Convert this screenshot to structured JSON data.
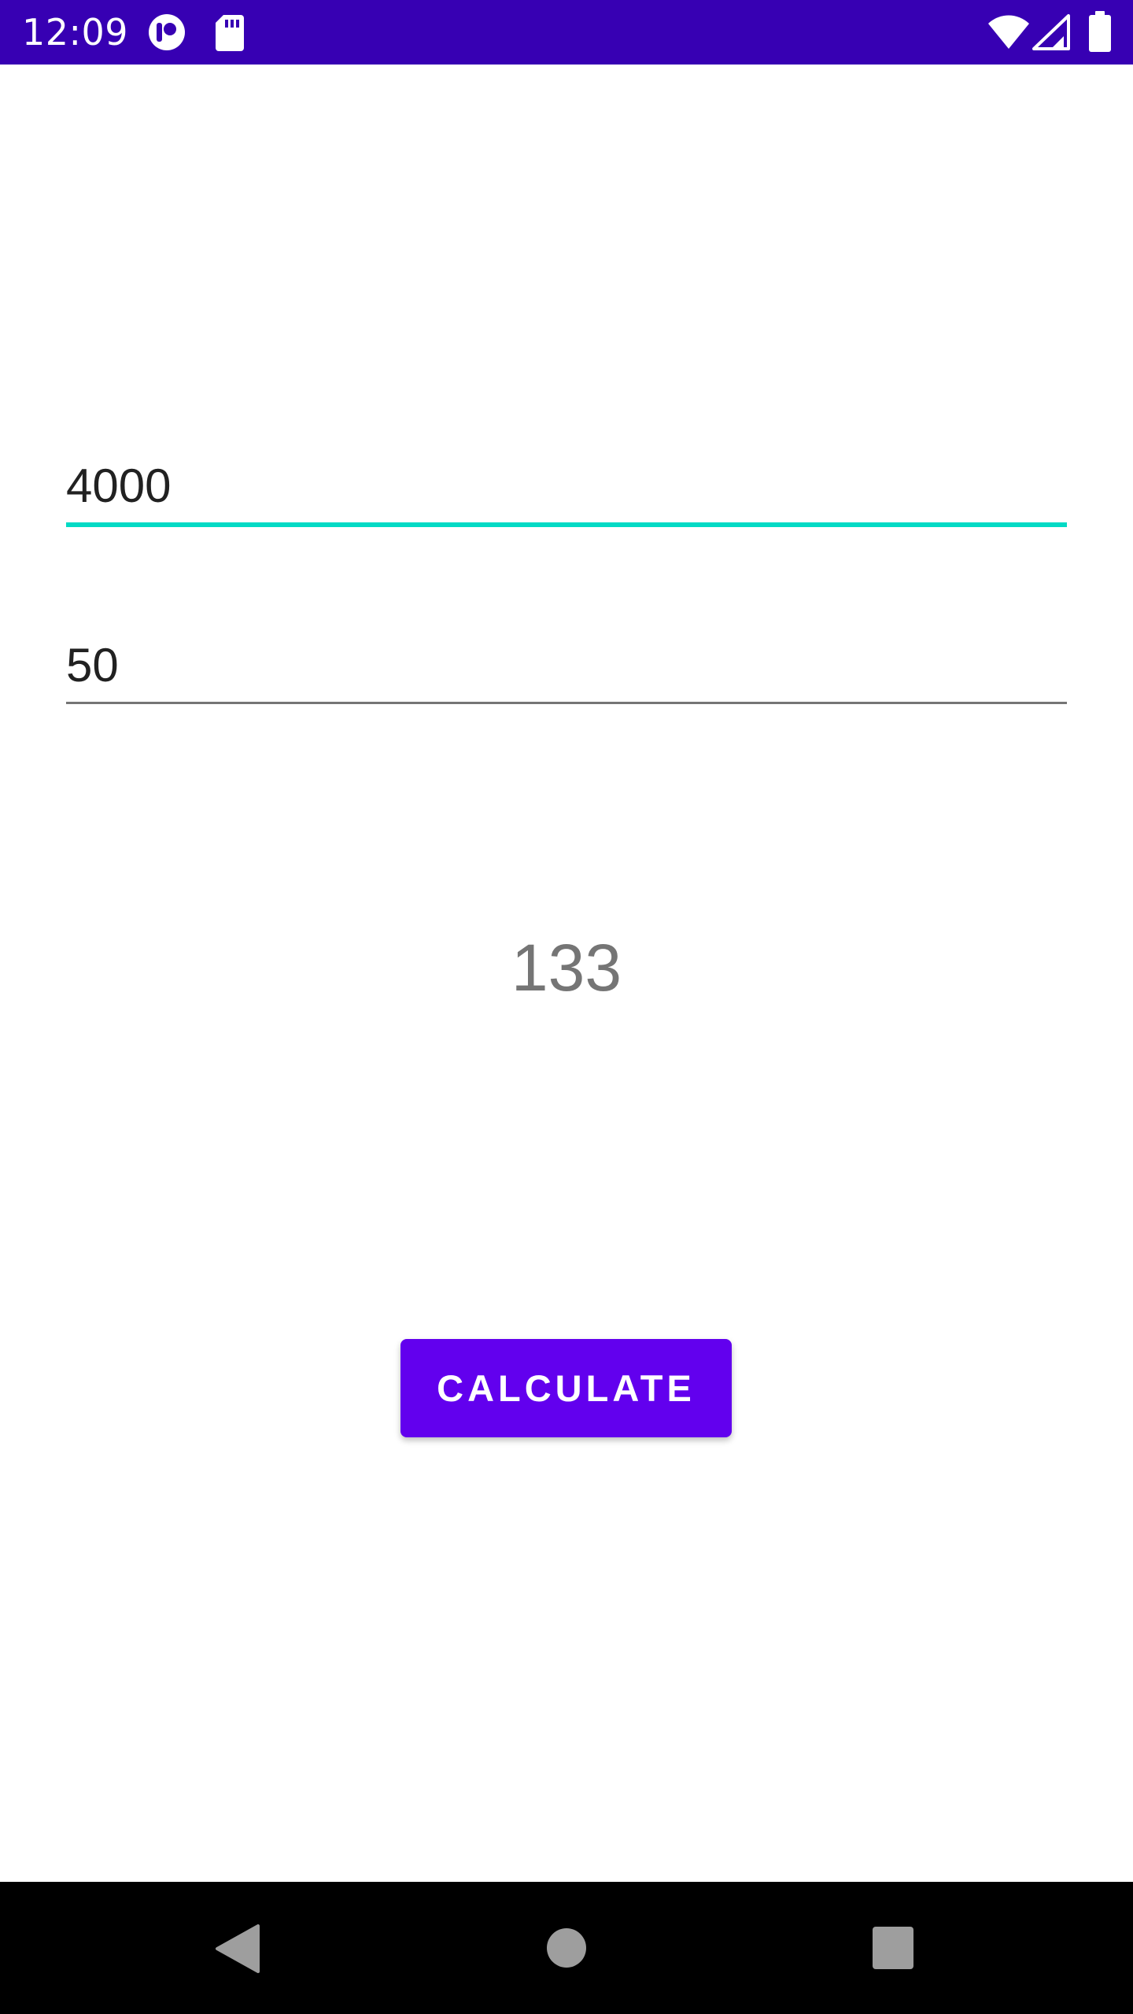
{
  "status_bar": {
    "time": "12:09",
    "background_color": "#3700B3",
    "icons": [
      "app-notification-icon",
      "sd-card-icon",
      "wifi-icon",
      "cell-signal-icon",
      "battery-icon"
    ]
  },
  "form": {
    "amount_value": "4000",
    "percent_value": "50",
    "focused_field_color": "#03DAC5"
  },
  "result": {
    "value": "133"
  },
  "button": {
    "label": "CALCULATE",
    "color": "#6200EE"
  },
  "nav_bar": {
    "icons": [
      "back-icon",
      "home-icon",
      "recents-icon"
    ]
  }
}
